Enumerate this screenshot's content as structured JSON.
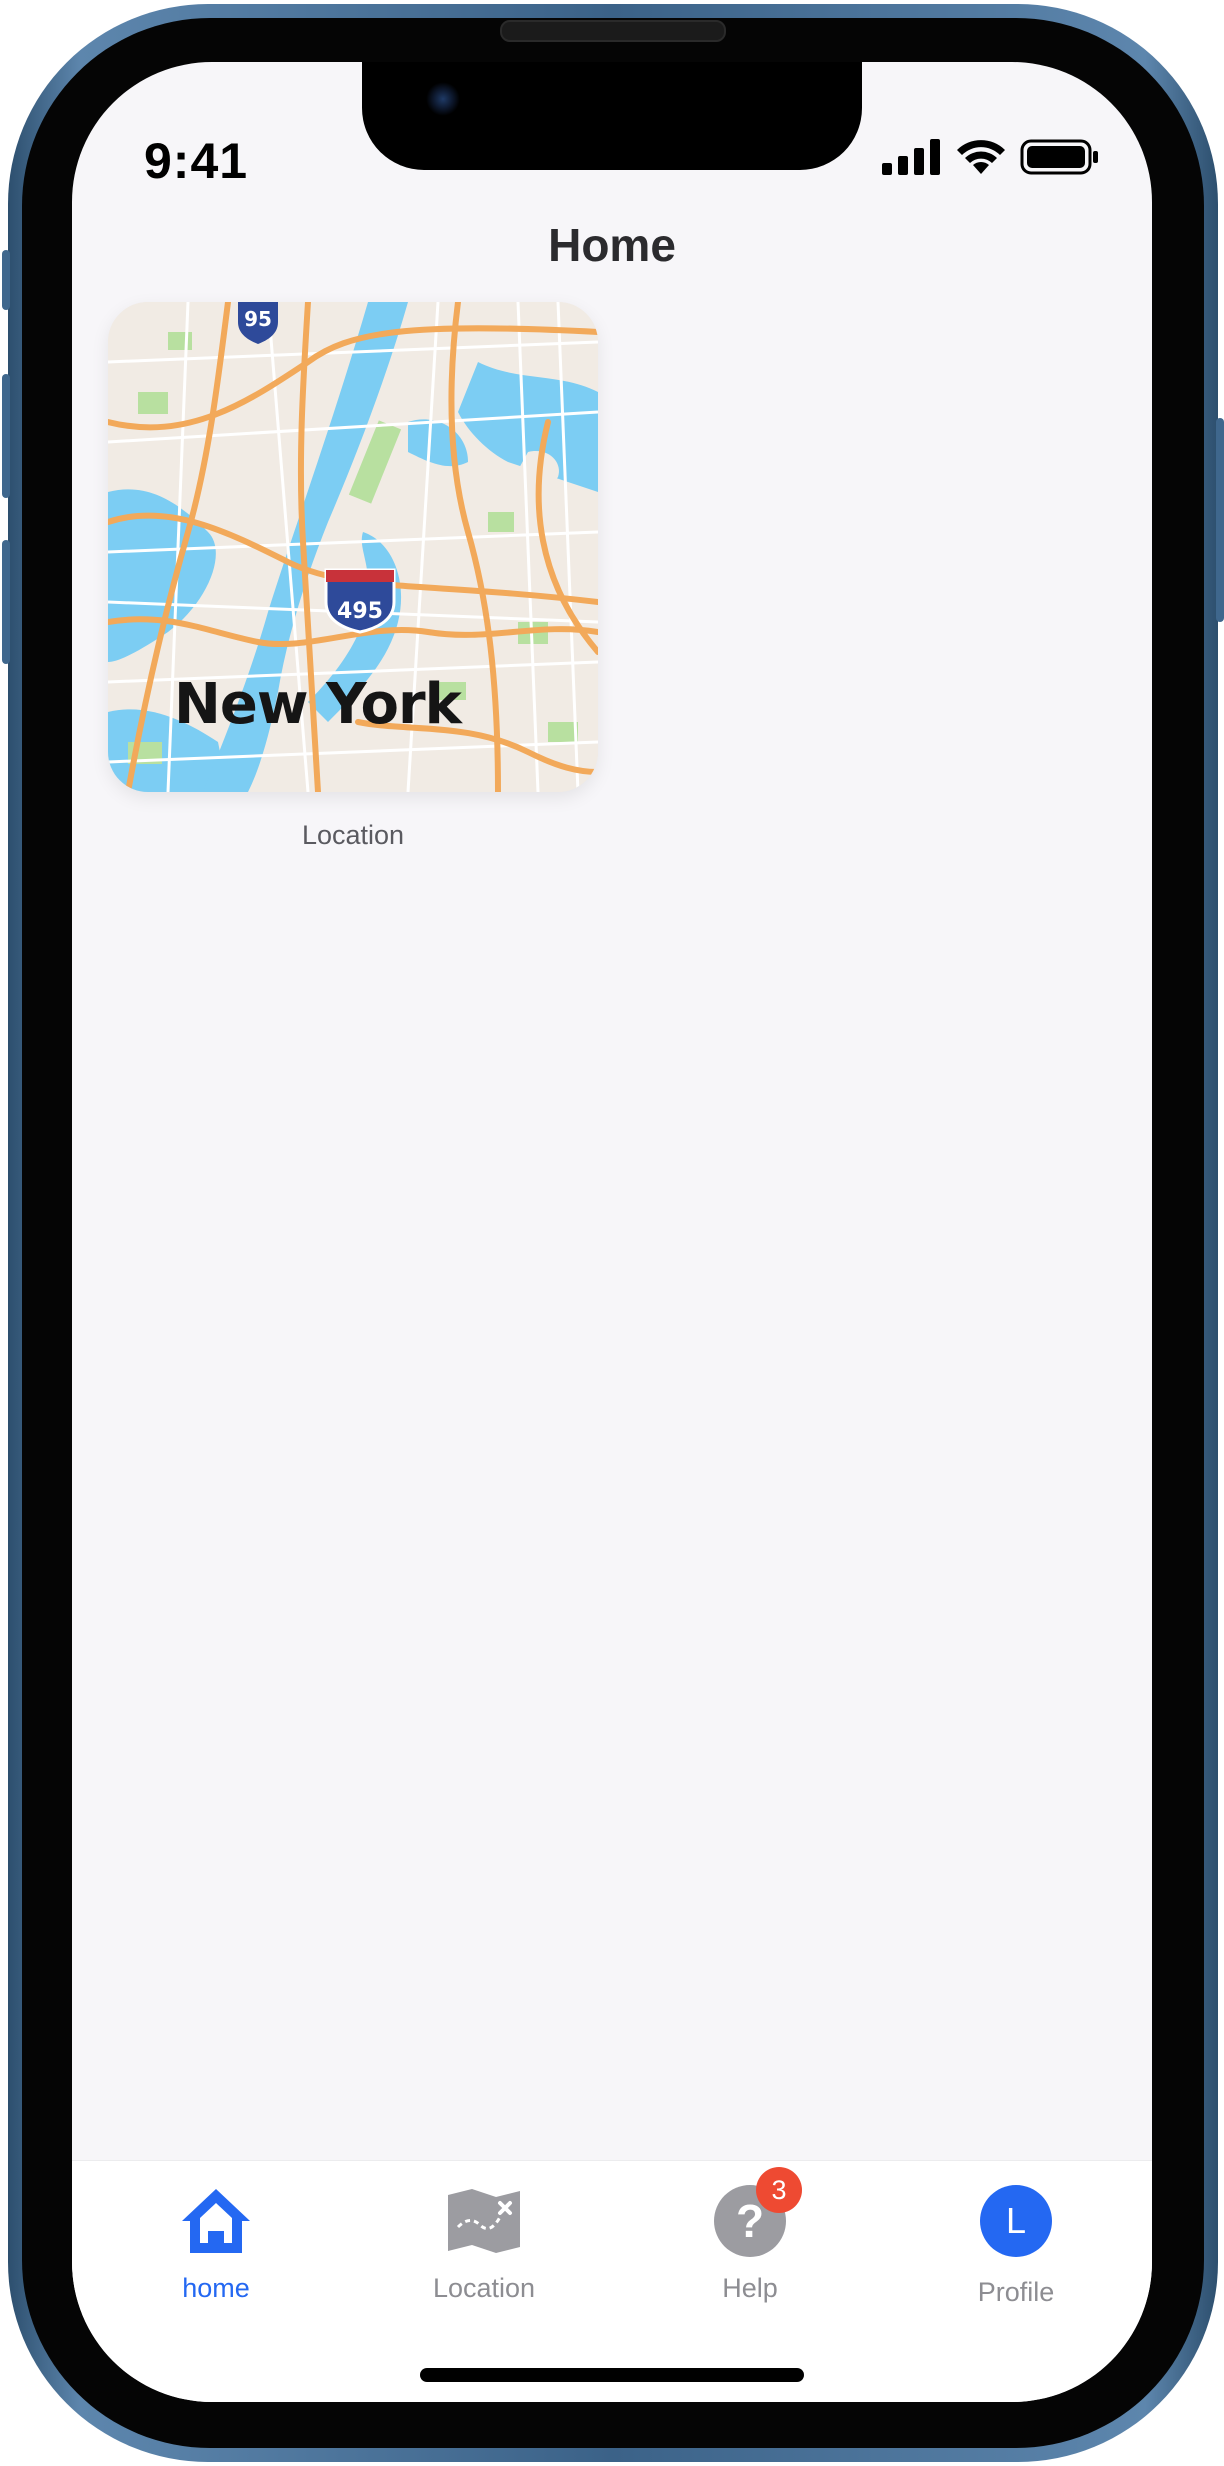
{
  "status_bar": {
    "time": "9:41"
  },
  "header": {
    "title": "Home"
  },
  "tiles": [
    {
      "map_city_label": "New York",
      "caption": "Location",
      "highway_shields": [
        "95",
        "495"
      ]
    }
  ],
  "tab_bar": {
    "active_color": "#2468f2",
    "inactive_color": "#8d8d92",
    "items": [
      {
        "label": "home",
        "icon": "home-icon",
        "active": true
      },
      {
        "label": "Location",
        "icon": "treasure-map-icon",
        "active": false
      },
      {
        "label": "Help",
        "icon": "question-icon",
        "badge": "3",
        "active": false
      },
      {
        "label": "Profile",
        "icon": "avatar",
        "avatar_initial": "L",
        "active": false
      }
    ]
  }
}
